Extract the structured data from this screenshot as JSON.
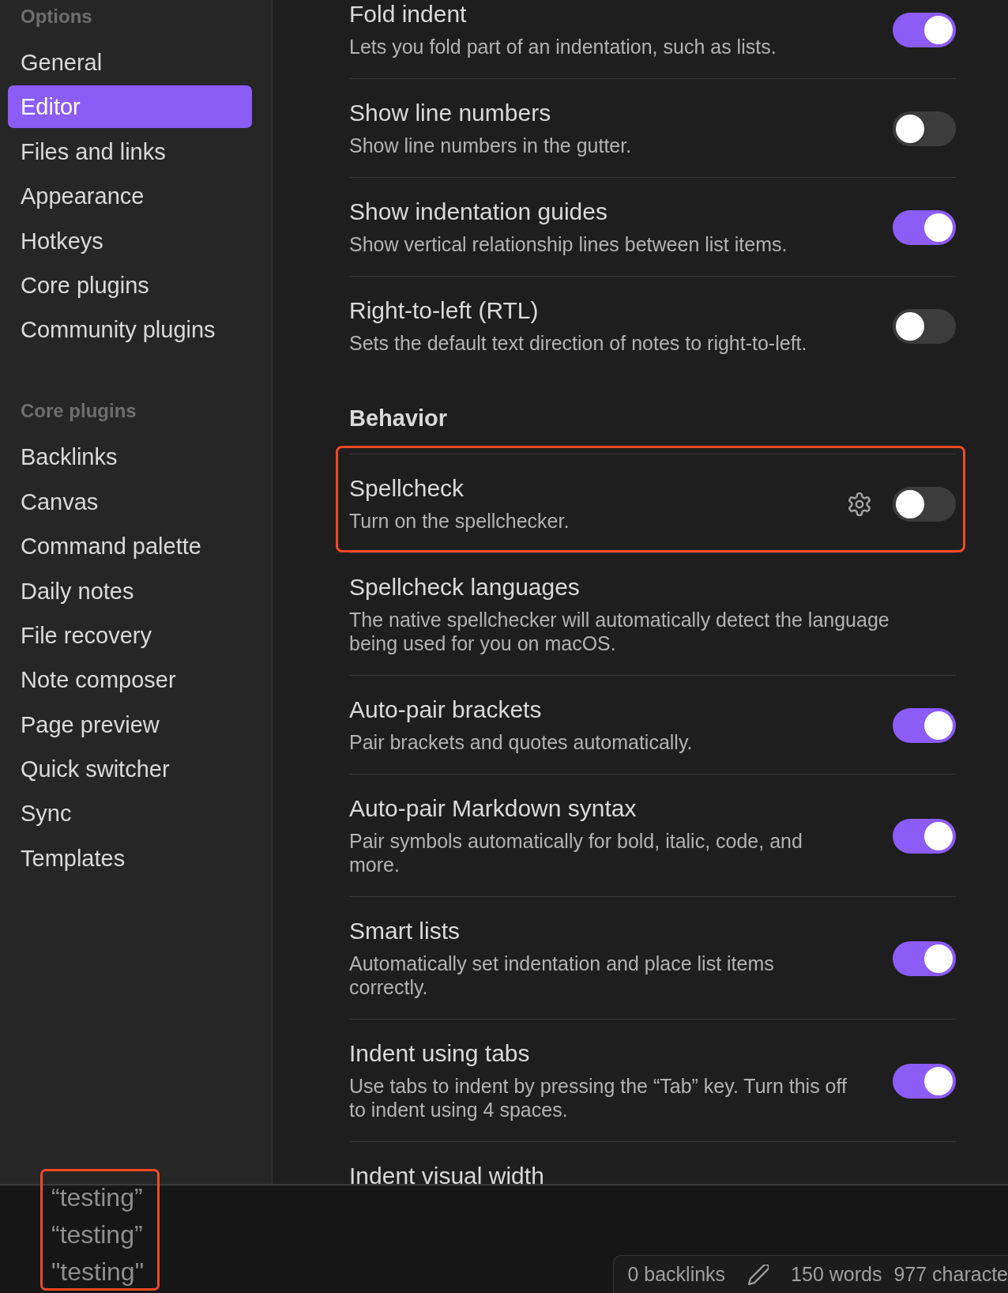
{
  "sidebar": {
    "sections": [
      {
        "heading": "Options",
        "items": [
          {
            "label": "General",
            "selected": false
          },
          {
            "label": "Editor",
            "selected": true
          },
          {
            "label": "Files and links",
            "selected": false
          },
          {
            "label": "Appearance",
            "selected": false
          },
          {
            "label": "Hotkeys",
            "selected": false
          },
          {
            "label": "Core plugins",
            "selected": false
          },
          {
            "label": "Community plugins",
            "selected": false
          }
        ]
      },
      {
        "heading": "Core plugins",
        "items": [
          {
            "label": "Backlinks",
            "selected": false
          },
          {
            "label": "Canvas",
            "selected": false
          },
          {
            "label": "Command palette",
            "selected": false
          },
          {
            "label": "Daily notes",
            "selected": false
          },
          {
            "label": "File recovery",
            "selected": false
          },
          {
            "label": "Note composer",
            "selected": false
          },
          {
            "label": "Page preview",
            "selected": false
          },
          {
            "label": "Quick switcher",
            "selected": false
          },
          {
            "label": "Sync",
            "selected": false
          },
          {
            "label": "Templates",
            "selected": false
          }
        ]
      }
    ]
  },
  "settings": [
    {
      "items": [
        {
          "kind": "toggle",
          "title": "Fold indent",
          "description": "Lets you fold part of an indentation, such as lists.",
          "on": true,
          "configurable": false,
          "highlighted": false
        },
        {
          "kind": "toggle",
          "title": "Show line numbers",
          "description": "Show line numbers in the gutter.",
          "on": false,
          "configurable": false,
          "highlighted": false
        },
        {
          "kind": "toggle",
          "title": "Show indentation guides",
          "description": "Show vertical relationship lines between list items.",
          "on": true,
          "configurable": false,
          "highlighted": false
        },
        {
          "kind": "toggle",
          "title": "Right-to-left (RTL)",
          "description": "Sets the default text direction of notes to right-to-left.",
          "on": false,
          "configurable": false,
          "highlighted": false
        }
      ]
    },
    {
      "heading": "Behavior",
      "items": [
        {
          "kind": "toggle",
          "title": "Spellcheck",
          "description": "Turn on the spellchecker.",
          "on": false,
          "configurable": true,
          "highlighted": true
        },
        {
          "kind": "info",
          "title": "Spellcheck languages",
          "description": "The native spellchecker will automatically detect the language being used for you on macOS.",
          "configurable": false,
          "highlighted": false
        },
        {
          "kind": "toggle",
          "title": "Auto-pair brackets",
          "description": "Pair brackets and quotes automatically.",
          "on": true,
          "configurable": false,
          "highlighted": false
        },
        {
          "kind": "toggle",
          "title": "Auto-pair Markdown syntax",
          "description": "Pair symbols automatically for bold, italic, code, and more.",
          "on": true,
          "configurable": false,
          "highlighted": false
        },
        {
          "kind": "toggle",
          "title": "Smart lists",
          "description": "Automatically set indentation and place list items correctly.",
          "on": true,
          "configurable": false,
          "highlighted": false
        },
        {
          "kind": "toggle",
          "title": "Indent using tabs",
          "description": "Use tabs to indent by pressing the “Tab” key. Turn this off to indent using 4 spaces.",
          "on": true,
          "configurable": false,
          "highlighted": false
        },
        {
          "kind": "info",
          "title": "Indent visual width",
          "configurable": false,
          "highlighted": false
        }
      ]
    }
  ],
  "editor": {
    "highlighted": true,
    "lines": [
      "“testing”",
      "“testing”",
      "\"testing\""
    ]
  },
  "status_bar": {
    "backlinks": "0 backlinks",
    "words": "150 words",
    "characters": "977 characte"
  }
}
